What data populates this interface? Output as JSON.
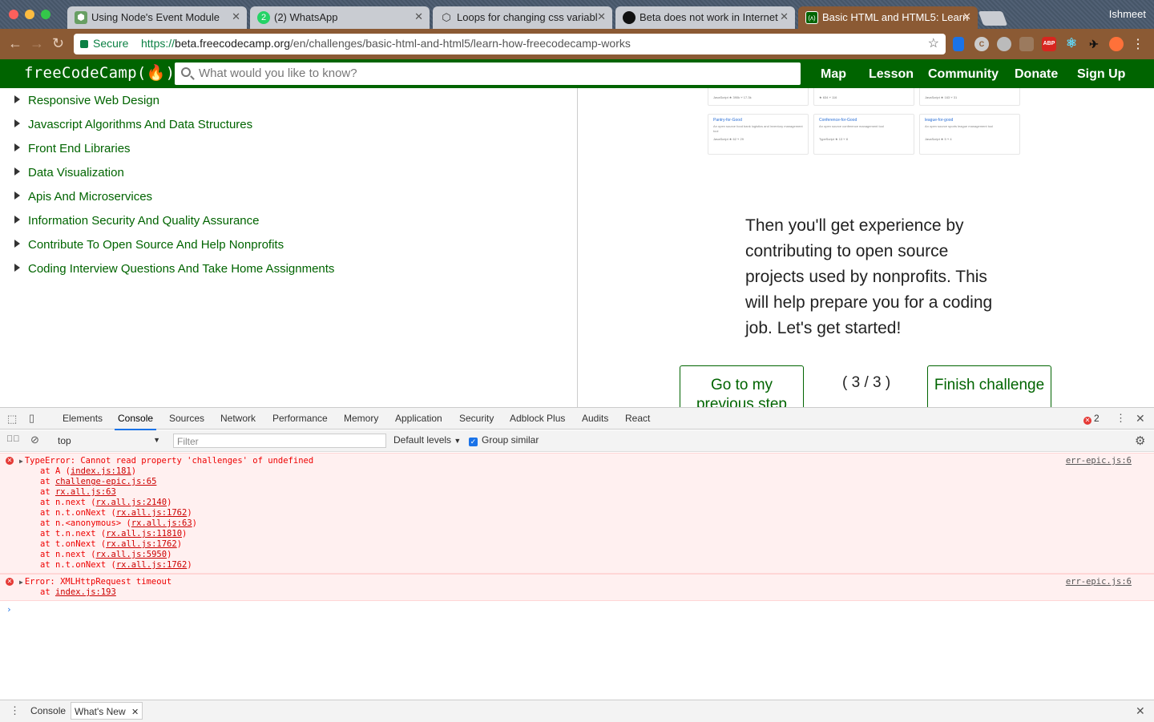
{
  "browser": {
    "tabs": [
      {
        "title": "Using Node's Event Module",
        "favicon": "node-icon",
        "color": "#689f63"
      },
      {
        "title": "(2) WhatsApp",
        "favicon": "whatsapp-icon",
        "color": "#25d366",
        "badge": "2"
      },
      {
        "title": "Loops for changing css variabl",
        "favicon": "codepen-icon",
        "color": "#333333"
      },
      {
        "title": "Beta does not work in Internet",
        "favicon": "github-icon",
        "color": "#111111"
      },
      {
        "title": "Basic HTML and HTML5: Learn",
        "favicon": "freecodecamp-icon",
        "color": "#006400",
        "active": true
      }
    ],
    "profile": "Ishmeet",
    "secure_label": "Secure",
    "url_scheme": "https://",
    "url_host": "beta.freecodecamp.org",
    "url_path": "/en/challenges/basic-html-and-html5/learn-how-freecodecamp-works",
    "extensions": [
      {
        "name": "bookmark-ext-icon",
        "color": "#1a73e8",
        "text": ""
      },
      {
        "name": "refresh-ext-icon",
        "color": "#cccccc",
        "text": "C"
      },
      {
        "name": "cloud-ext-icon",
        "color": "#bbbbbb",
        "text": ""
      },
      {
        "name": "wave-ext-icon",
        "color": "#9b7a5e",
        "text": ""
      },
      {
        "name": "adblock-plus-icon",
        "color": "#d8261f",
        "text": "ABP"
      },
      {
        "name": "react-devtools-icon",
        "color": "#61dafb",
        "text": ""
      },
      {
        "name": "bird-ext-icon",
        "color": "#222222",
        "text": ""
      },
      {
        "name": "fox-ext-icon",
        "color": "#ff7139",
        "text": ""
      }
    ]
  },
  "fcc": {
    "logo": "freeCodeCamp(🔥)",
    "search_placeholder": "What would you like to know?",
    "nav": [
      "Map",
      "Lesson",
      "Community",
      "Donate",
      "Sign Up"
    ],
    "brand_color": "#006400"
  },
  "sidebar": {
    "items": [
      "Responsive Web Design",
      "Javascript Algorithms And Data Structures",
      "Front End Libraries",
      "Data Visualization",
      "Apis And Microservices",
      "Information Security And Quality Assurance",
      "Contribute To Open Source And Help Nonprofits",
      "Coding Interview Questions And Take Home Assignments"
    ]
  },
  "lesson": {
    "cards_row1": [
      {
        "meta": "JavaScript ★ 390k ⑂ 17.3k"
      },
      {
        "meta": "★ 634 ⑂ 116"
      },
      {
        "meta": "JavaScript ★ 163 ⑂ 31"
      }
    ],
    "cards_row2": [
      {
        "title": "Pantry-for-Good",
        "desc": "An open source food bank logistics and inventory management tool",
        "meta": "JavaScript ★ 62 ⑂ 29"
      },
      {
        "title": "Conference-for-Good",
        "desc": "An open source conference management tool",
        "meta": "TypeScript ★ 13 ⑂ 8"
      },
      {
        "title": "league-for-good",
        "desc": "An open source sports league management tool",
        "meta": "JavaScript ★ 5 ⑂ 4"
      }
    ],
    "text": "Then you'll get experience by contributing to open source projects used by nonprofits. This will help prepare you for a coding job. Let's get started!",
    "prev_button": "Go to my previous step",
    "progress": "( 3 / 3 )",
    "finish_button": "Finish challenge"
  },
  "devtools": {
    "tabs": [
      "Elements",
      "Console",
      "Sources",
      "Network",
      "Performance",
      "Memory",
      "Application",
      "Security",
      "Adblock Plus",
      "Audits",
      "React"
    ],
    "active_tab": "Console",
    "error_count": "2",
    "context": "top",
    "filter_placeholder": "Filter",
    "levels": "Default levels",
    "group_similar": "Group similar",
    "messages": [
      {
        "head": "TypeError: Cannot read property 'challenges' of undefined",
        "source": "err-epic.js:6",
        "frames": [
          {
            "pre": "at A (",
            "link": "index.js:181",
            "post": ")"
          },
          {
            "pre": "at ",
            "link": "challenge-epic.js:65",
            "post": ""
          },
          {
            "pre": "at ",
            "link": "rx.all.js:63",
            "post": ""
          },
          {
            "pre": "at n.next (",
            "link": "rx.all.js:2140",
            "post": ")"
          },
          {
            "pre": "at n.t.onNext (",
            "link": "rx.all.js:1762",
            "post": ")"
          },
          {
            "pre": "at n.<anonymous> (",
            "link": "rx.all.js:63",
            "post": ")"
          },
          {
            "pre": "at t.n.next (",
            "link": "rx.all.js:11810",
            "post": ")"
          },
          {
            "pre": "at t.onNext (",
            "link": "rx.all.js:1762",
            "post": ")"
          },
          {
            "pre": "at n.next (",
            "link": "rx.all.js:5950",
            "post": ")"
          },
          {
            "pre": "at n.t.onNext (",
            "link": "rx.all.js:1762",
            "post": ")"
          }
        ]
      },
      {
        "head": "Error: XMLHttpRequest timeout",
        "source": "err-epic.js:6",
        "frames": [
          {
            "pre": "at ",
            "link": "index.js:193",
            "post": ""
          }
        ]
      }
    ],
    "drawer_tabs": [
      "Console",
      "What's New"
    ]
  }
}
